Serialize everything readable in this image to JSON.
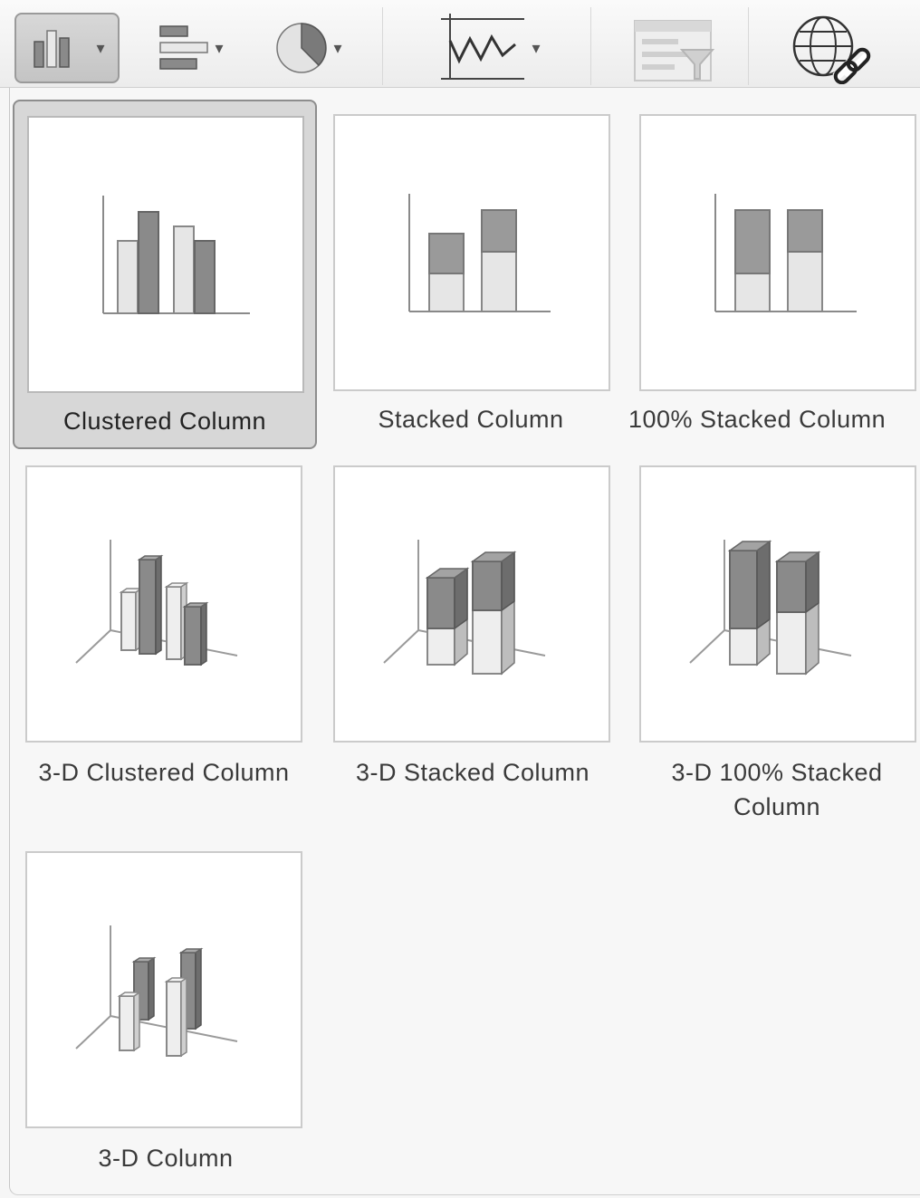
{
  "toolbar": {
    "buttons": [
      {
        "name": "column-chart",
        "icon": "column-chart-icon",
        "has_menu": true,
        "active": true
      },
      {
        "name": "bar-chart",
        "icon": "bar-chart-icon",
        "has_menu": true
      },
      {
        "name": "pie-chart",
        "icon": "pie-chart-icon",
        "has_menu": true
      },
      {
        "name": "line-chart",
        "icon": "line-chart-icon",
        "has_menu": true
      },
      {
        "name": "filter",
        "icon": "filter-icon",
        "has_menu": false
      },
      {
        "name": "hyperlink",
        "icon": "globe-link-icon",
        "has_menu": false
      }
    ]
  },
  "chart_types": [
    {
      "label": "Clustered Column",
      "selected": true
    },
    {
      "label": "Stacked Column"
    },
    {
      "label": "100% Stacked Column"
    },
    {
      "label": "3-D Clustered Column"
    },
    {
      "label": "3-D Stacked Column"
    },
    {
      "label": "3-D 100% Stacked Column"
    },
    {
      "label": "3-D Column"
    }
  ],
  "colors": {
    "bar_dark": "#8a8a8a",
    "bar_light": "#e6e6e6",
    "selected_bg": "#d7d7d7"
  }
}
